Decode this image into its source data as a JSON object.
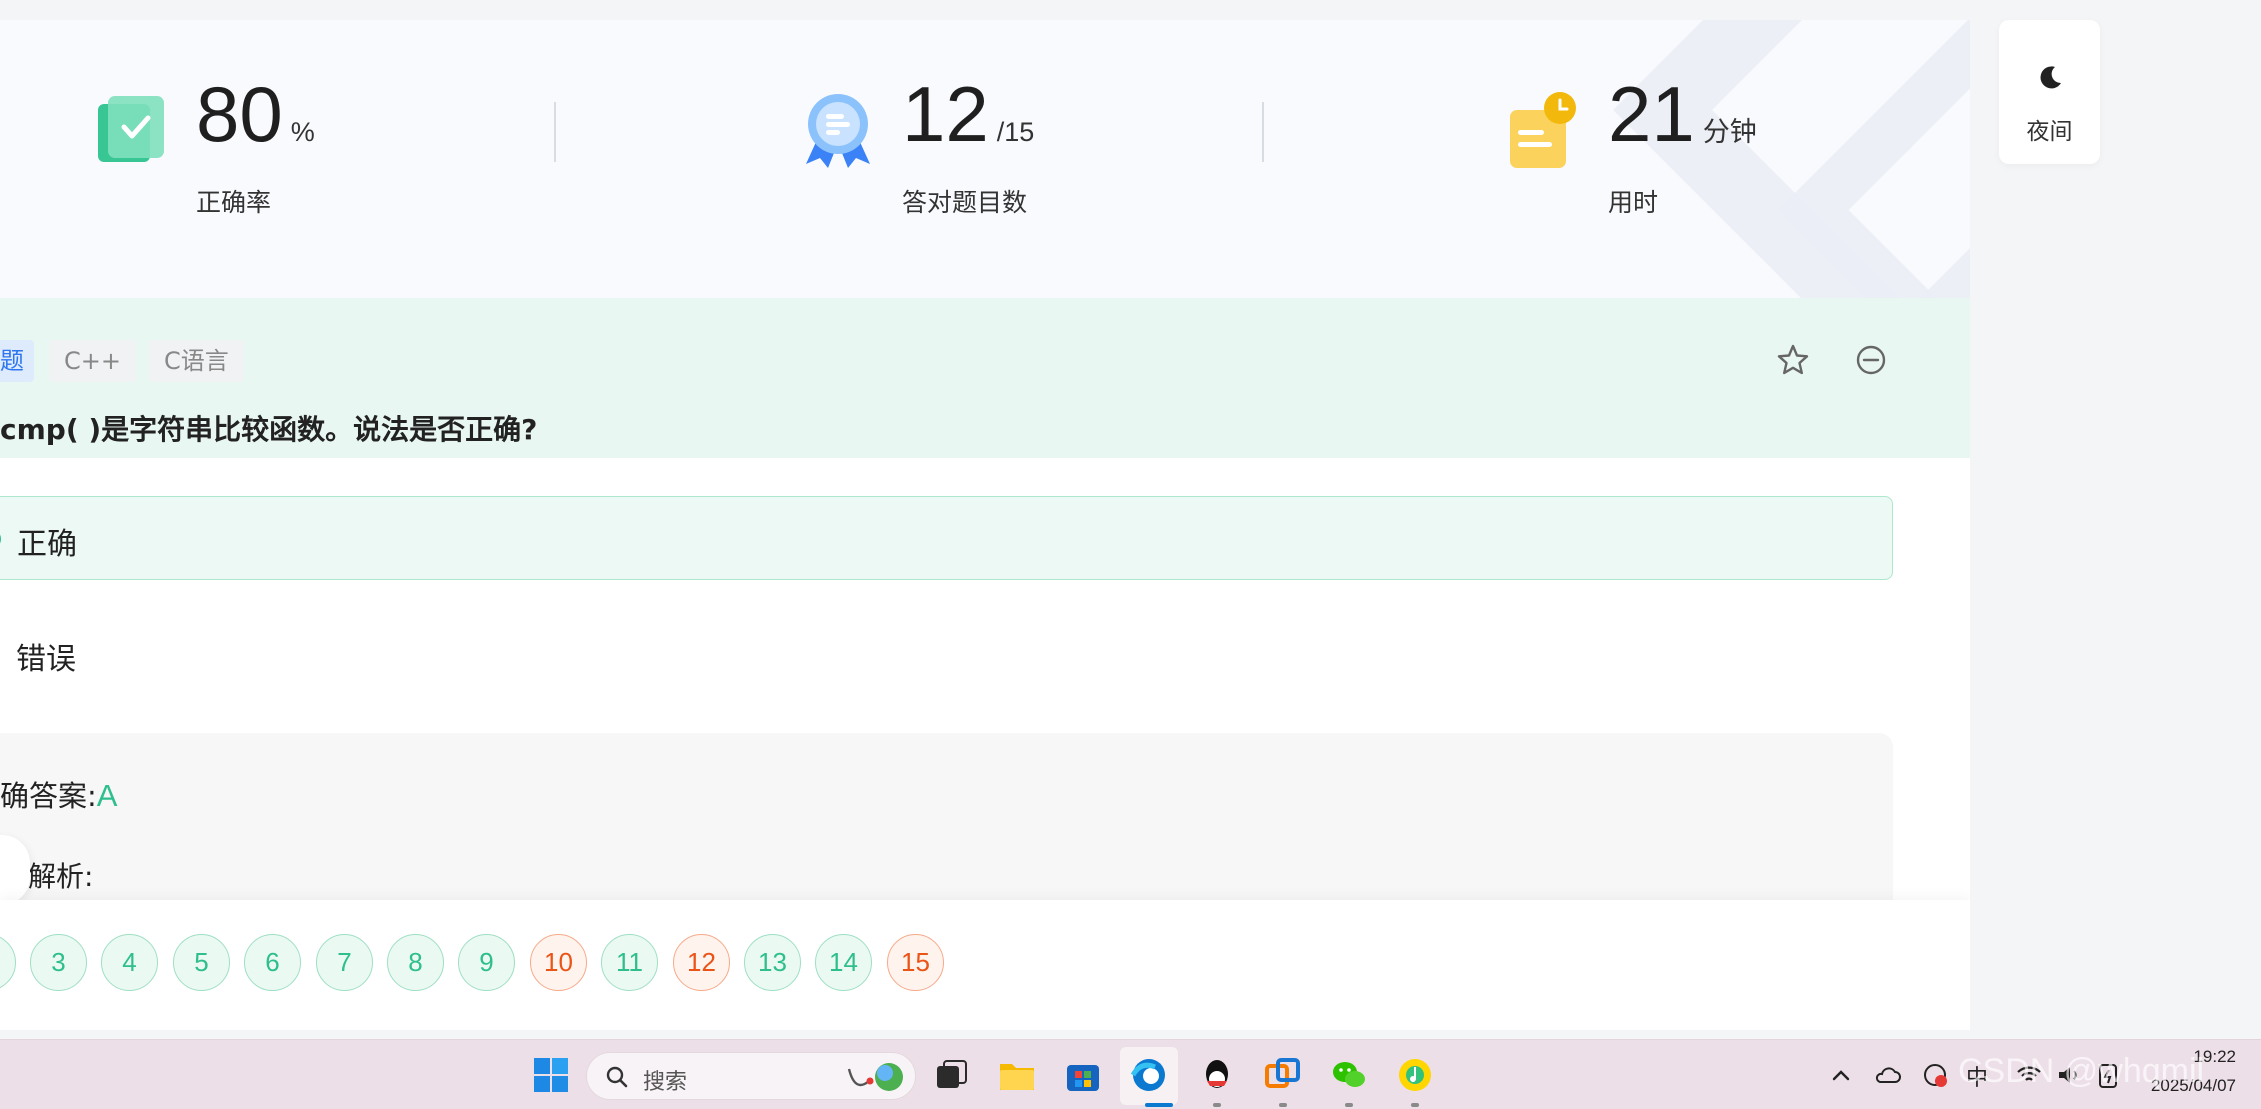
{
  "stats": {
    "accuracy": {
      "value": "80",
      "unit": "%",
      "label": "正确率"
    },
    "correct": {
      "value": "12",
      "unit": "/15",
      "label": "答对题目数"
    },
    "time": {
      "value": "21",
      "unit": "分钟",
      "label": "用时"
    }
  },
  "night_mode": {
    "label": "夜间",
    "icon": "moon-icon"
  },
  "question": {
    "tags": [
      "题",
      "C++",
      "C语言"
    ],
    "text": "cmp( )是字符串比较函数。说法是否正确?",
    "options": [
      {
        "label": "正确",
        "selected": true
      },
      {
        "label": "错误",
        "selected": false
      }
    ],
    "actions": {
      "favorite_icon": "star-icon",
      "remove_icon": "minus-circle-icon"
    }
  },
  "answer": {
    "label": "确答案:",
    "value": "A",
    "analysis_label": "解析:"
  },
  "question_nav": [
    {
      "num": "3",
      "status": "correct"
    },
    {
      "num": "4",
      "status": "correct"
    },
    {
      "num": "5",
      "status": "correct"
    },
    {
      "num": "6",
      "status": "correct"
    },
    {
      "num": "7",
      "status": "correct"
    },
    {
      "num": "8",
      "status": "correct"
    },
    {
      "num": "9",
      "status": "correct"
    },
    {
      "num": "10",
      "status": "wrong"
    },
    {
      "num": "11",
      "status": "correct"
    },
    {
      "num": "12",
      "status": "wrong"
    },
    {
      "num": "13",
      "status": "correct"
    },
    {
      "num": "14",
      "status": "correct"
    },
    {
      "num": "15",
      "status": "wrong"
    }
  ],
  "colors": {
    "accent_green": "#2fbf8c",
    "error_orange": "#ea5417",
    "tag_blue": "#2e76f0"
  },
  "taskbar": {
    "search_placeholder": "搜索",
    "ime": "中",
    "time": "19:22",
    "date": "2025/04/07",
    "watermark": "CSDN @whqmil",
    "apps": [
      "start-icon",
      "task-view-icon",
      "file-explorer-icon",
      "store-icon",
      "edge-icon",
      "qq-icon",
      "remote-desktop-icon",
      "wechat-icon",
      "qq-music-icon"
    ]
  }
}
